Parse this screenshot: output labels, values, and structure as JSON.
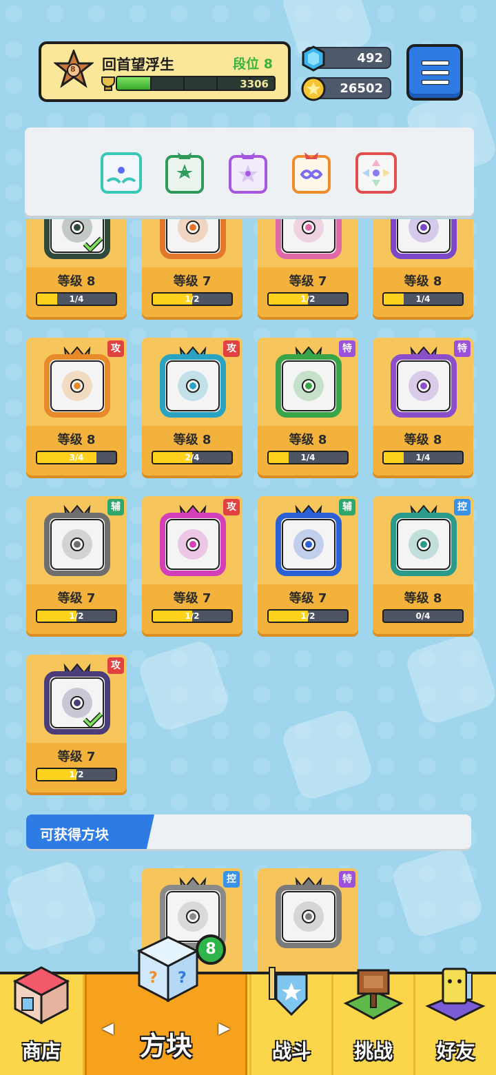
{
  "player": {
    "name": "回首望浮生",
    "rank_badge": "8",
    "tier_label": "段位 8",
    "xp_value": "3306",
    "xp_fraction": 0.21
  },
  "currency": {
    "gems": "492",
    "coins": "26502"
  },
  "filters": [
    {
      "icon": "hands-die-skin-icon",
      "accent": "#38c8b8"
    },
    {
      "icon": "green-dragon-die-skin-icon",
      "accent": "#2d9a5a"
    },
    {
      "icon": "purple-dragon-die-skin-icon",
      "accent": "#a657e0"
    },
    {
      "icon": "rainbow-dragon-die-skin-icon",
      "accent": "#f08c2a"
    },
    {
      "icon": "rainbow-die-skin-icon",
      "accent": "#e24d4d"
    }
  ],
  "dice_rows": [
    [
      {
        "level": "等级 8",
        "progress": "1/4",
        "ratio": 0.25,
        "color": "#2f4a3a",
        "tag": "",
        "tag_class": "",
        "owned": true
      },
      {
        "level": "等级 7",
        "progress": "1/2",
        "ratio": 0.5,
        "color": "#e3772b",
        "tag": "",
        "tag_class": "",
        "owned": false
      },
      {
        "level": "等级 7",
        "progress": "1/2",
        "ratio": 0.5,
        "color": "#e06aa8",
        "tag": "",
        "tag_class": "",
        "owned": false
      },
      {
        "level": "等级 8",
        "progress": "1/4",
        "ratio": 0.25,
        "color": "#7a48c8",
        "tag": "",
        "tag_class": "",
        "owned": false
      }
    ],
    [
      {
        "level": "等级 8",
        "progress": "3/4",
        "ratio": 0.75,
        "color": "#e78a2a",
        "tag": "攻",
        "tag_class": "atk",
        "owned": false
      },
      {
        "level": "等级 8",
        "progress": "2/4",
        "ratio": 0.5,
        "color": "#2aa2c2",
        "tag": "攻",
        "tag_class": "atk",
        "owned": false
      },
      {
        "level": "等级 8",
        "progress": "1/4",
        "ratio": 0.25,
        "color": "#3aa548",
        "tag": "特",
        "tag_class": "spc",
        "owned": false
      },
      {
        "level": "等级 8",
        "progress": "1/4",
        "ratio": 0.25,
        "color": "#8a4fc9",
        "tag": "特",
        "tag_class": "spc",
        "owned": false
      }
    ],
    [
      {
        "level": "等级 7",
        "progress": "1/2",
        "ratio": 0.5,
        "color": "#6e6e6e",
        "tag": "辅",
        "tag_class": "sup",
        "owned": false
      },
      {
        "level": "等级 7",
        "progress": "1/2",
        "ratio": 0.5,
        "color": "#d23fb8",
        "tag": "攻",
        "tag_class": "atk",
        "owned": false
      },
      {
        "level": "等级 7",
        "progress": "1/2",
        "ratio": 0.5,
        "color": "#2b5fd4",
        "tag": "辅",
        "tag_class": "sup",
        "owned": false
      },
      {
        "level": "等级 8",
        "progress": "0/4",
        "ratio": 0,
        "color": "#2a9a8a",
        "tag": "控",
        "tag_class": "ctl",
        "owned": false
      }
    ],
    [
      {
        "level": "等级 7",
        "progress": "1/2",
        "ratio": 0.5,
        "color": "#4b3d7a",
        "tag": "攻",
        "tag_class": "atk",
        "owned": true
      }
    ]
  ],
  "obtainable": {
    "title": "可获得方块",
    "items": [
      {
        "tag": "控",
        "tag_class": "ctl",
        "color": "#8a8a8a"
      },
      {
        "tag": "特",
        "tag_class": "spc",
        "color": "#7a7a7a"
      }
    ]
  },
  "nav": {
    "shop": "商店",
    "dice": "方块",
    "battle": "战斗",
    "challenge": "挑战",
    "friends": "好友",
    "dice_badge": "8",
    "prev_arrow": "◀",
    "next_arrow": "▶"
  }
}
